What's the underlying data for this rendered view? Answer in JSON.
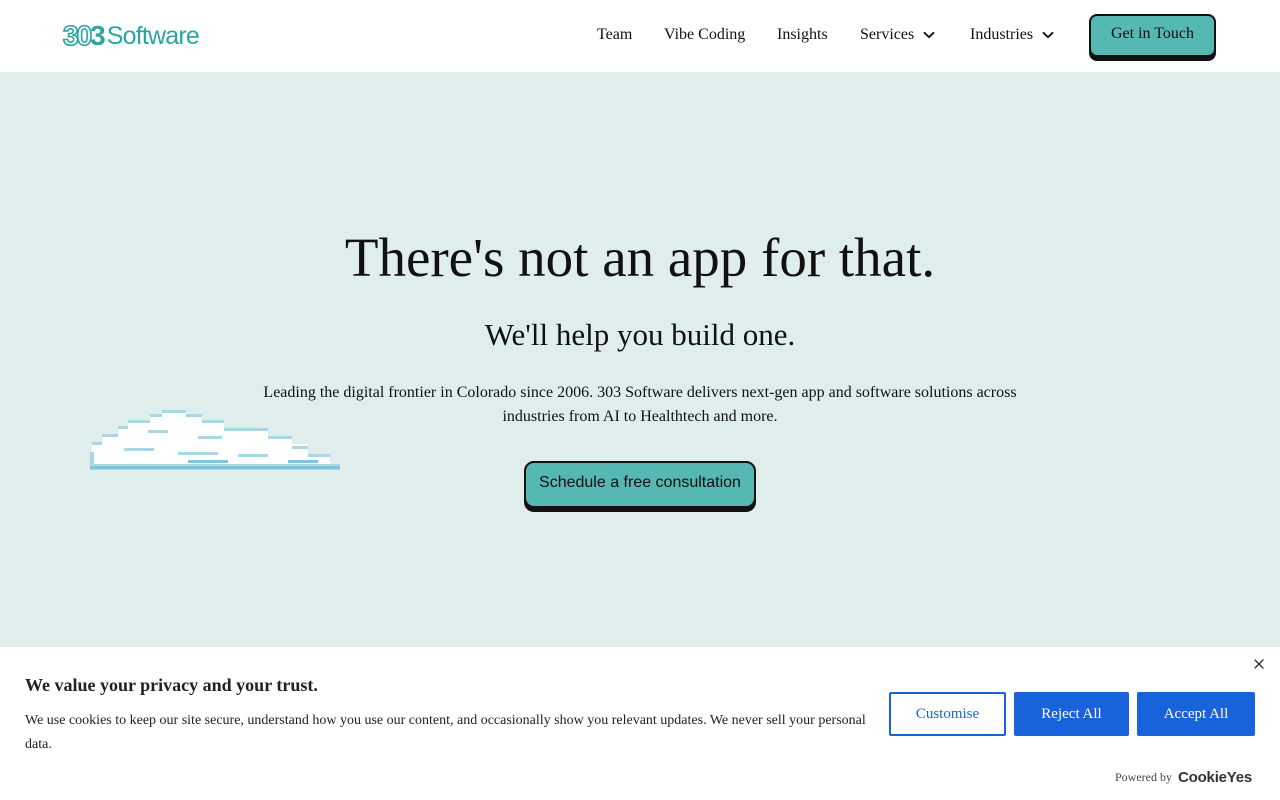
{
  "header": {
    "logo": {
      "digit_1": "3",
      "digit_2": "0",
      "digit_3": "3",
      "word": "Software",
      "color": "#2aa5a0"
    },
    "nav": {
      "team": "Team",
      "vibe_coding": "Vibe Coding",
      "insights": "Insights",
      "services": "Services",
      "industries": "Industries"
    },
    "cta_label": "Get in Touch"
  },
  "hero": {
    "title": "There's not an app for that.",
    "subtitle": "We'll help you build one.",
    "description": "Leading the digital frontier in Colorado since 2006. 303 Software delivers next-gen app and software solutions across industries from AI to Healthtech and more.",
    "cta_label": "Schedule a free consultation",
    "background": "#dfeded",
    "accent": "#55b8b3"
  },
  "cookie_banner": {
    "title": "We value your privacy and your trust.",
    "text": "We use cookies to keep our site secure, understand how you use our content, and occasionally show you relevant updates. We never sell your personal data.",
    "customise_label": "Customise",
    "reject_label": "Reject All",
    "accept_label": "Accept All",
    "powered_by": "Powered by",
    "brand": "CookieYes",
    "button_color": "#1863dc"
  },
  "icons": {
    "chevron": "chevron-down-icon",
    "close": "close-icon",
    "cloud": "pixel-cloud"
  }
}
